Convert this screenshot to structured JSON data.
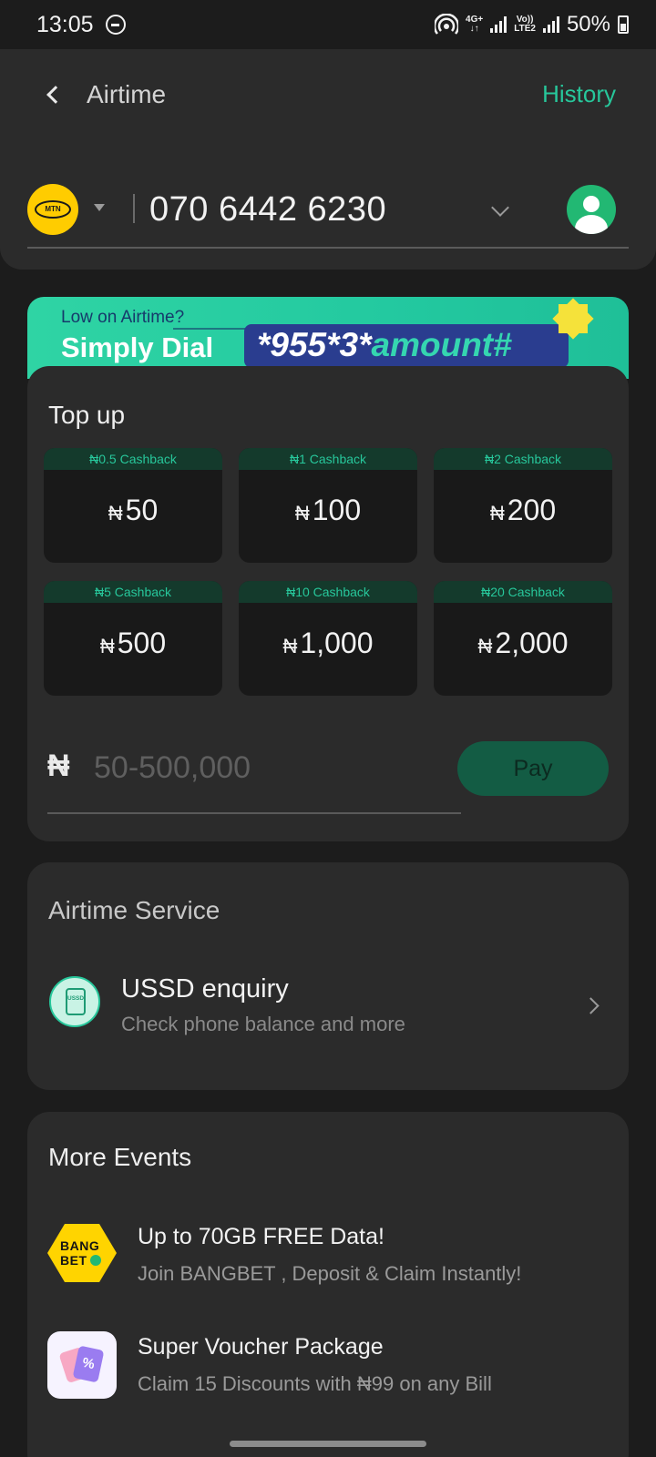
{
  "status_bar": {
    "time": "13:05",
    "network_top": "4G+",
    "volte_top": "Vo))",
    "volte_bottom": "LTE2",
    "battery": "50%"
  },
  "header": {
    "title": "Airtime",
    "history_label": "History"
  },
  "phone": {
    "network_logo": "MTN",
    "number": "070 6442 6230"
  },
  "promo": {
    "line1": "Low on Airtime?",
    "line2": "Simply Dial",
    "code_main": "*955*3*",
    "code_accent": "amount#"
  },
  "topup": {
    "title": "Top up",
    "currency_symbol": "₦",
    "tiles": [
      {
        "cashback": "₦0.5 Cashback",
        "amount": "50"
      },
      {
        "cashback": "₦1 Cashback",
        "amount": "100"
      },
      {
        "cashback": "₦2 Cashback",
        "amount": "200"
      },
      {
        "cashback": "₦5 Cashback",
        "amount": "500"
      },
      {
        "cashback": "₦10 Cashback",
        "amount": "1,000"
      },
      {
        "cashback": "₦20 Cashback",
        "amount": "2,000"
      }
    ],
    "input_placeholder": "50-500,000",
    "pay_label": "Pay"
  },
  "airtime_service": {
    "title": "Airtime Service",
    "ussd": {
      "icon_label": "USSD",
      "title": "USSD enquiry",
      "subtitle": "Check phone balance and more"
    }
  },
  "more_events": {
    "title": "More Events",
    "items": [
      {
        "logo_line1": "BANG",
        "logo_line2": "BET",
        "title": "Up to 70GB FREE Data!",
        "subtitle": "Join BANGBET , Deposit & Claim Instantly!"
      },
      {
        "icon_symbol": "%",
        "title": "Super Voucher Package",
        "subtitle": "Claim 15 Discounts with ₦99 on any Bill"
      }
    ]
  },
  "colors": {
    "accent": "#27c79b",
    "background": "#1c1c1c",
    "card": "#2b2b2b",
    "tile": "#191919"
  }
}
